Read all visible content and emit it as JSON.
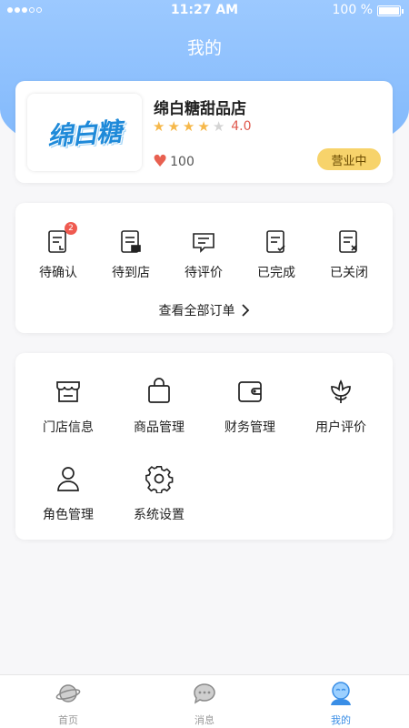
{
  "status_bar": {
    "time": "11:27 AM",
    "battery": "100 %"
  },
  "header": {
    "title": "我的"
  },
  "store": {
    "name": "绵白糖甜品店",
    "logo_text": "绵白糖",
    "rating": "4.0",
    "stars_filled": 4,
    "stars_total": 5,
    "likes": "100",
    "status": "营业中"
  },
  "orders": {
    "items": [
      {
        "label": "待确认",
        "icon": "order-pending-icon",
        "badge": "2"
      },
      {
        "label": "待到店",
        "icon": "order-arrival-icon"
      },
      {
        "label": "待评价",
        "icon": "order-review-icon"
      },
      {
        "label": "已完成",
        "icon": "order-done-icon"
      },
      {
        "label": "已关闭",
        "icon": "order-closed-icon"
      }
    ],
    "view_all": "查看全部订单"
  },
  "tools": [
    {
      "label": "门店信息",
      "icon": "store-icon"
    },
    {
      "label": "商品管理",
      "icon": "shopping-bag-icon"
    },
    {
      "label": "财务管理",
      "icon": "wallet-icon"
    },
    {
      "label": "用户评价",
      "icon": "flower-icon"
    },
    {
      "label": "角色管理",
      "icon": "user-icon"
    },
    {
      "label": "系统设置",
      "icon": "gear-icon"
    }
  ],
  "tabbar": [
    {
      "label": "首页",
      "icon": "planet-icon",
      "active": false
    },
    {
      "label": "消息",
      "icon": "chat-bubble-icon",
      "active": false
    },
    {
      "label": "我的",
      "icon": "profile-icon",
      "active": true
    }
  ],
  "colors": {
    "accent": "#3a8ee6",
    "hero": "#8fc0fd",
    "badge_open": "#f7d36b",
    "star": "#f6b84a",
    "heart": "#e86050"
  }
}
